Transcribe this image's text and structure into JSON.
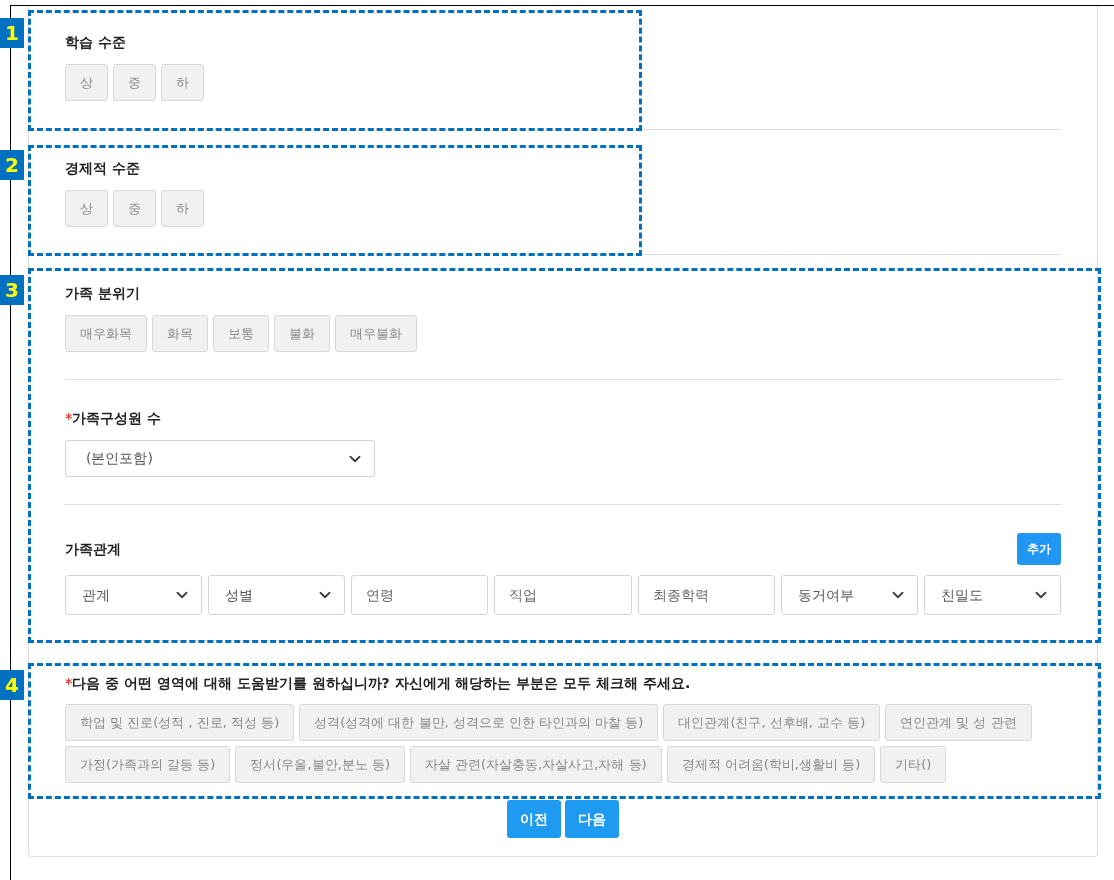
{
  "choice_sections": [
    {
      "title": "학습 수준",
      "options": [
        {
          "label": "상",
          "selected": false
        },
        {
          "label": "중",
          "selected": false
        },
        {
          "label": "하",
          "selected": false
        }
      ]
    },
    {
      "title": "경제적 수준",
      "options": [
        {
          "label": "상",
          "selected": false
        },
        {
          "label": "중",
          "selected": false
        },
        {
          "label": "하",
          "selected": false
        }
      ]
    },
    {
      "title": "가족 분위기",
      "options": [
        {
          "label": "매우화목",
          "selected": false
        },
        {
          "label": "화목",
          "selected": false
        },
        {
          "label": "보통",
          "selected": false
        },
        {
          "label": "불화",
          "selected": false
        },
        {
          "label": "매우불화",
          "selected": false
        }
      ]
    }
  ],
  "member_count": {
    "required_mark": "*",
    "title": "가족구성원 수",
    "value": "(본인포함)"
  },
  "family_relations": {
    "title": "가족관계",
    "add_button": "추가",
    "fields": [
      {
        "kind": "select",
        "value": "관계"
      },
      {
        "kind": "select",
        "value": "성별"
      },
      {
        "kind": "input",
        "placeholder": "연령"
      },
      {
        "kind": "input",
        "placeholder": "직업"
      },
      {
        "kind": "input",
        "placeholder": "최종학력"
      },
      {
        "kind": "select",
        "value": "동거여부"
      },
      {
        "kind": "select",
        "value": "친밀도"
      }
    ]
  },
  "help_areas": {
    "required_mark": "*",
    "question": "다음 중 어떤 영역에 대해 도움받기를 원하십니까? 자신에게 해당하는 부분은 모두 체크해 주세요.",
    "options": [
      {
        "label": "학업 및 진로(성적 , 진로, 적성 등)",
        "selected": false
      },
      {
        "label": "성격(성격에 대한 불만, 성격으로 인한 타인과의 마찰 등)",
        "selected": false
      },
      {
        "label": "대인관계(친구, 선후배, 교수 등)",
        "selected": false
      },
      {
        "label": "연인관계 및 성 관련",
        "selected": false
      },
      {
        "label": "가정(가족과의 갈등 등)",
        "selected": false
      },
      {
        "label": "정서(우울,불안,분노 등)",
        "selected": false
      },
      {
        "label": "자살 관련(자살충동,자살사고,자해 등)",
        "selected": false
      },
      {
        "label": "경제적 어려움(학비,생활비 등)",
        "selected": false
      },
      {
        "label": "기타()",
        "selected": false
      }
    ]
  },
  "nav_buttons": [
    "이전",
    "다음"
  ],
  "annotations": [
    "1",
    "2",
    "3",
    "4"
  ]
}
